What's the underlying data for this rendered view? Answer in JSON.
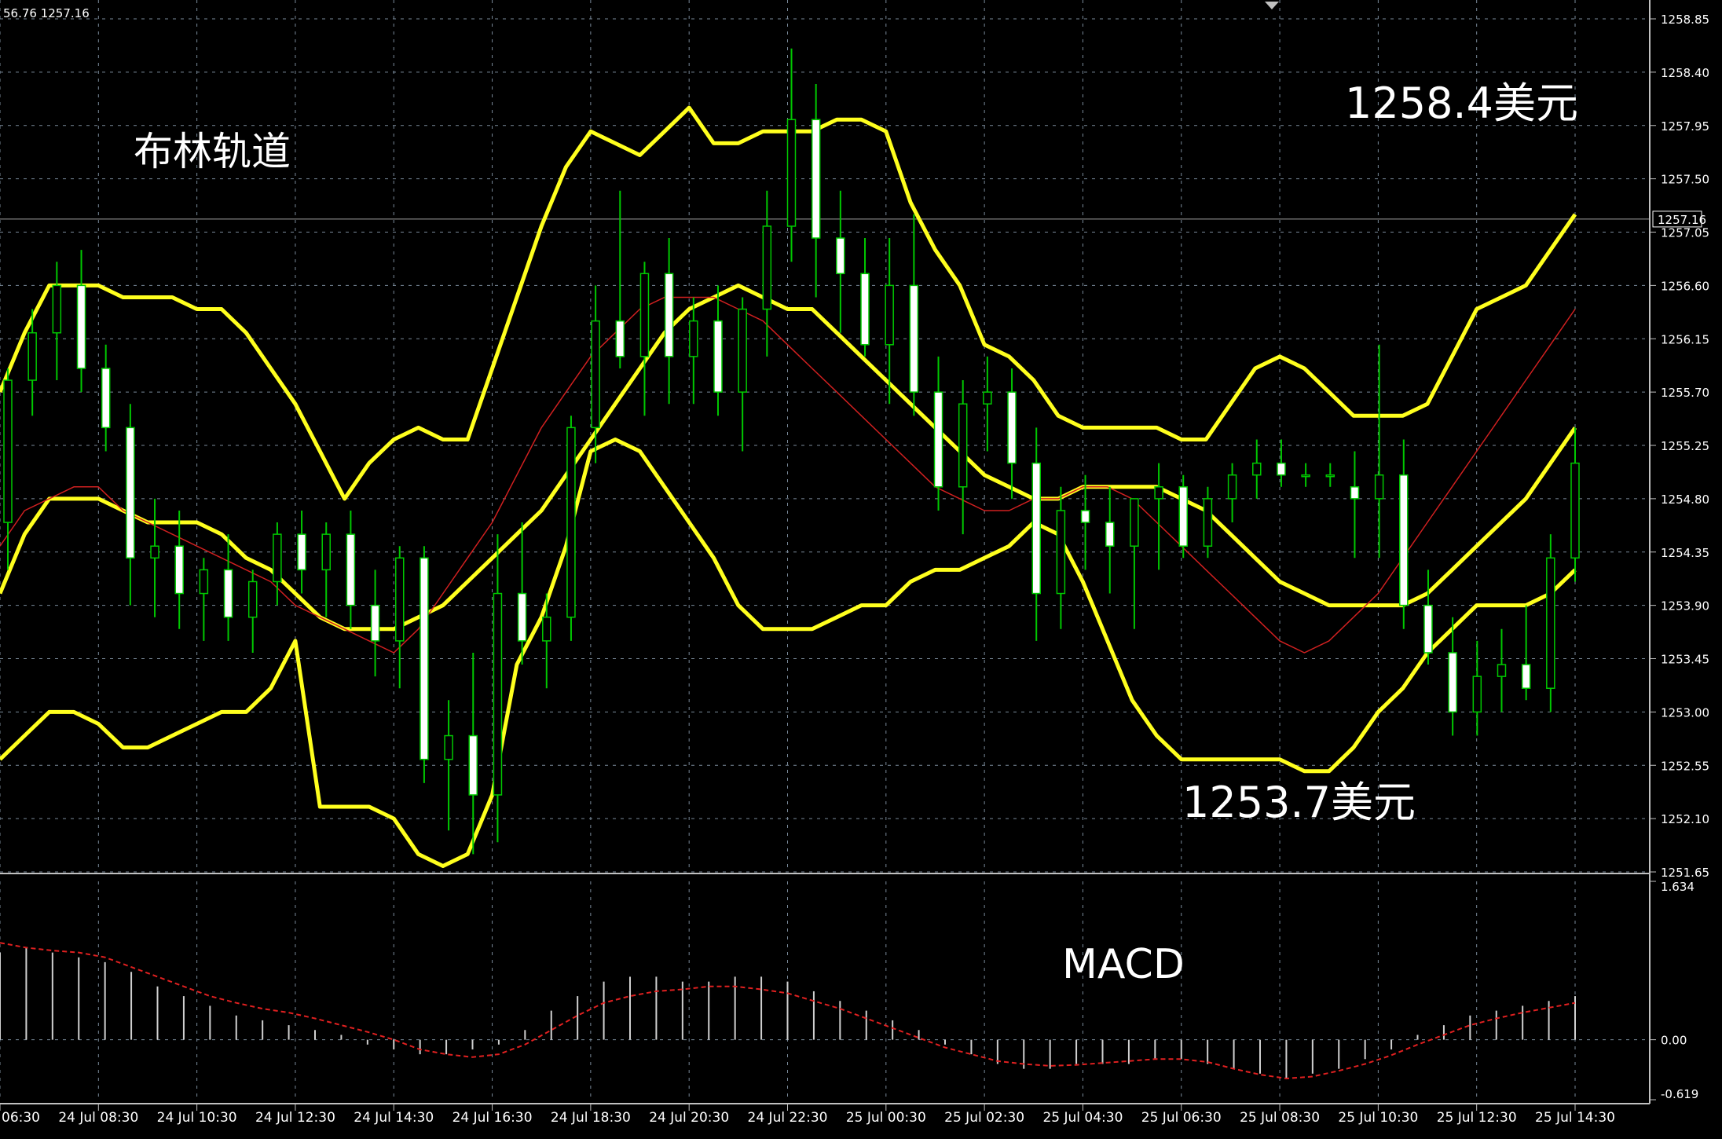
{
  "header": {
    "ohlc_readout": "56.76 1257.16"
  },
  "annotations": {
    "bollinger_label": "布林轨道",
    "high_label": "1258.4美元",
    "low_label": "1253.7美元",
    "macd_label": "MACD"
  },
  "colors": {
    "background": "#000000",
    "grid": "#7a8a9a",
    "candle_wick": "#00c800",
    "candle_bull_fill": "#000000",
    "candle_bear_fill": "#ffffff",
    "bollinger": "#ffff1e",
    "moving_average": "#d02020",
    "macd_histogram": "#d0d0d0",
    "macd_signal": "#e02020",
    "text": "#ffffff"
  },
  "chart_data": [
    {
      "type": "candlestick",
      "title": "",
      "price_ticks": [
        "1258.85",
        "1258.40",
        "1257.95",
        "1257.50",
        "1257.05",
        "1256.60",
        "1256.15",
        "1255.70",
        "1255.25",
        "1254.80",
        "1254.35",
        "1253.90",
        "1253.45",
        "1253.00",
        "1252.55",
        "1252.10",
        "1251.65"
      ],
      "price_ylim": [
        1251.65,
        1258.85
      ],
      "current_price": "1257.16",
      "time_ticks": [
        "06:30",
        "24 Jul 08:30",
        "24 Jul 10:30",
        "24 Jul 12:30",
        "24 Jul 14:30",
        "24 Jul 16:30",
        "24 Jul 18:30",
        "24 Jul 20:30",
        "24 Jul 22:30",
        "25 Jul 00:30",
        "25 Jul 02:30",
        "25 Jul 04:30",
        "25 Jul 06:30",
        "25 Jul 08:30",
        "25 Jul 10:30",
        "25 Jul 12:30",
        "25 Jul 14:30"
      ],
      "bollinger_upper": [
        1255.7,
        1256.2,
        1256.6,
        1256.6,
        1256.6,
        1256.5,
        1256.5,
        1256.5,
        1256.4,
        1256.4,
        1256.2,
        1255.9,
        1255.6,
        1255.2,
        1254.8,
        1255.1,
        1255.3,
        1255.4,
        1255.3,
        1255.3,
        1255.9,
        1256.5,
        1257.1,
        1257.6,
        1257.9,
        1257.8,
        1257.7,
        1257.9,
        1258.1,
        1257.8,
        1257.8,
        1257.9,
        1257.9,
        1257.9,
        1258.0,
        1258.0,
        1257.9,
        1257.3,
        1256.9,
        1256.6,
        1256.1,
        1256.0,
        1255.8,
        1255.5,
        1255.4,
        1255.4,
        1255.4,
        1255.4,
        1255.3,
        1255.3,
        1255.6,
        1255.9,
        1256.0,
        1255.9,
        1255.7,
        1255.5,
        1255.5,
        1255.5,
        1255.6,
        1256.0,
        1256.4,
        1256.5,
        1256.6,
        1256.9,
        1257.2
      ],
      "bollinger_middle": [
        1254.0,
        1254.5,
        1254.8,
        1254.8,
        1254.8,
        1254.7,
        1254.6,
        1254.6,
        1254.6,
        1254.5,
        1254.3,
        1254.2,
        1254.0,
        1253.8,
        1253.7,
        1253.7,
        1253.7,
        1253.8,
        1253.9,
        1254.1,
        1254.3,
        1254.5,
        1254.7,
        1255.0,
        1255.3,
        1255.6,
        1255.9,
        1256.2,
        1256.4,
        1256.5,
        1256.6,
        1256.5,
        1256.4,
        1256.4,
        1256.2,
        1256.0,
        1255.8,
        1255.6,
        1255.4,
        1255.2,
        1255.0,
        1254.9,
        1254.8,
        1254.8,
        1254.9,
        1254.9,
        1254.9,
        1254.9,
        1254.8,
        1254.7,
        1254.5,
        1254.3,
        1254.1,
        1254.0,
        1253.9,
        1253.9,
        1253.9,
        1253.9,
        1254.0,
        1254.2,
        1254.4,
        1254.6,
        1254.8,
        1255.1,
        1255.4
      ],
      "bollinger_lower": [
        1252.6,
        1252.8,
        1253.0,
        1253.0,
        1252.9,
        1252.7,
        1252.7,
        1252.8,
        1252.9,
        1253.0,
        1253.0,
        1253.2,
        1253.6,
        1252.2,
        1252.2,
        1252.2,
        1252.1,
        1251.8,
        1251.7,
        1251.8,
        1252.3,
        1253.4,
        1253.8,
        1254.4,
        1255.2,
        1255.3,
        1255.2,
        1254.9,
        1254.6,
        1254.3,
        1253.9,
        1253.7,
        1253.7,
        1253.7,
        1253.8,
        1253.9,
        1253.9,
        1254.1,
        1254.2,
        1254.2,
        1254.3,
        1254.4,
        1254.6,
        1254.5,
        1254.1,
        1253.6,
        1253.1,
        1252.8,
        1252.6,
        1252.6,
        1252.6,
        1252.6,
        1252.6,
        1252.5,
        1252.5,
        1252.7,
        1253.0,
        1253.2,
        1253.5,
        1253.7,
        1253.9,
        1253.9,
        1253.9,
        1254.0,
        1254.2
      ],
      "moving_average": [
        1254.4,
        1254.7,
        1254.8,
        1254.9,
        1254.9,
        1254.7,
        1254.6,
        1254.5,
        1254.4,
        1254.3,
        1254.2,
        1254.1,
        1253.9,
        1253.8,
        1253.7,
        1253.6,
        1253.5,
        1253.7,
        1254.0,
        1254.3,
        1254.6,
        1255.0,
        1255.4,
        1255.7,
        1256.0,
        1256.2,
        1256.4,
        1256.5,
        1256.5,
        1256.5,
        1256.4,
        1256.3,
        1256.1,
        1255.9,
        1255.7,
        1255.5,
        1255.3,
        1255.1,
        1254.9,
        1254.8,
        1254.7,
        1254.7,
        1254.8,
        1254.8,
        1254.9,
        1254.9,
        1254.8,
        1254.6,
        1254.4,
        1254.2,
        1254.0,
        1253.8,
        1253.6,
        1253.5,
        1253.6,
        1253.8,
        1254.0,
        1254.3,
        1254.6,
        1254.9,
        1255.2,
        1255.5,
        1255.8,
        1256.1,
        1256.4
      ],
      "candles": [
        {
          "o": 1254.6,
          "h": 1255.9,
          "l": 1254.2,
          "c": 1255.8
        },
        {
          "o": 1255.8,
          "h": 1256.4,
          "l": 1255.5,
          "c": 1256.2
        },
        {
          "o": 1256.2,
          "h": 1256.8,
          "l": 1255.8,
          "c": 1256.6
        },
        {
          "o": 1256.6,
          "h": 1256.9,
          "l": 1255.7,
          "c": 1255.9
        },
        {
          "o": 1255.9,
          "h": 1256.1,
          "l": 1255.2,
          "c": 1255.4
        },
        {
          "o": 1255.4,
          "h": 1255.6,
          "l": 1253.9,
          "c": 1254.3
        },
        {
          "o": 1254.3,
          "h": 1254.8,
          "l": 1253.8,
          "c": 1254.4
        },
        {
          "o": 1254.4,
          "h": 1254.7,
          "l": 1253.7,
          "c": 1254.0
        },
        {
          "o": 1254.0,
          "h": 1254.3,
          "l": 1253.6,
          "c": 1254.2
        },
        {
          "o": 1254.2,
          "h": 1254.5,
          "l": 1253.6,
          "c": 1253.8
        },
        {
          "o": 1253.8,
          "h": 1254.2,
          "l": 1253.5,
          "c": 1254.1
        },
        {
          "o": 1254.1,
          "h": 1254.6,
          "l": 1253.9,
          "c": 1254.5
        },
        {
          "o": 1254.5,
          "h": 1254.7,
          "l": 1254.0,
          "c": 1254.2
        },
        {
          "o": 1254.2,
          "h": 1254.6,
          "l": 1253.8,
          "c": 1254.5
        },
        {
          "o": 1254.5,
          "h": 1254.7,
          "l": 1253.7,
          "c": 1253.9
        },
        {
          "o": 1253.9,
          "h": 1254.2,
          "l": 1253.3,
          "c": 1253.6
        },
        {
          "o": 1253.6,
          "h": 1254.4,
          "l": 1253.2,
          "c": 1254.3
        },
        {
          "o": 1254.3,
          "h": 1254.4,
          "l": 1252.4,
          "c": 1252.6
        },
        {
          "o": 1252.6,
          "h": 1253.1,
          "l": 1252.0,
          "c": 1252.8
        },
        {
          "o": 1252.8,
          "h": 1253.5,
          "l": 1251.8,
          "c": 1252.3
        },
        {
          "o": 1252.3,
          "h": 1254.5,
          "l": 1251.9,
          "c": 1254.0
        },
        {
          "o": 1254.0,
          "h": 1254.6,
          "l": 1253.4,
          "c": 1253.6
        },
        {
          "o": 1253.6,
          "h": 1254.0,
          "l": 1253.2,
          "c": 1253.8
        },
        {
          "o": 1253.8,
          "h": 1255.5,
          "l": 1253.6,
          "c": 1255.4
        },
        {
          "o": 1255.4,
          "h": 1256.6,
          "l": 1255.1,
          "c": 1256.3
        },
        {
          "o": 1256.3,
          "h": 1257.4,
          "l": 1255.9,
          "c": 1256.0
        },
        {
          "o": 1256.0,
          "h": 1256.8,
          "l": 1255.5,
          "c": 1256.7
        },
        {
          "o": 1256.7,
          "h": 1257.0,
          "l": 1255.6,
          "c": 1256.0
        },
        {
          "o": 1256.0,
          "h": 1256.5,
          "l": 1255.6,
          "c": 1256.3
        },
        {
          "o": 1256.3,
          "h": 1256.6,
          "l": 1255.5,
          "c": 1255.7
        },
        {
          "o": 1255.7,
          "h": 1256.5,
          "l": 1255.2,
          "c": 1256.4
        },
        {
          "o": 1256.4,
          "h": 1257.4,
          "l": 1256.0,
          "c": 1257.1
        },
        {
          "o": 1257.1,
          "h": 1258.6,
          "l": 1256.8,
          "c": 1258.0
        },
        {
          "o": 1258.0,
          "h": 1258.3,
          "l": 1256.5,
          "c": 1257.0
        },
        {
          "o": 1257.0,
          "h": 1257.4,
          "l": 1256.2,
          "c": 1256.7
        },
        {
          "o": 1256.7,
          "h": 1257.0,
          "l": 1256.0,
          "c": 1256.1
        },
        {
          "o": 1256.1,
          "h": 1257.0,
          "l": 1255.6,
          "c": 1256.6
        },
        {
          "o": 1256.6,
          "h": 1257.2,
          "l": 1255.5,
          "c": 1255.7
        },
        {
          "o": 1255.7,
          "h": 1256.0,
          "l": 1254.7,
          "c": 1254.9
        },
        {
          "o": 1254.9,
          "h": 1255.8,
          "l": 1254.5,
          "c": 1255.6
        },
        {
          "o": 1255.6,
          "h": 1256.0,
          "l": 1255.2,
          "c": 1255.7
        },
        {
          "o": 1255.7,
          "h": 1255.9,
          "l": 1254.8,
          "c": 1255.1
        },
        {
          "o": 1255.1,
          "h": 1255.4,
          "l": 1253.6,
          "c": 1254.0
        },
        {
          "o": 1254.0,
          "h": 1254.9,
          "l": 1253.7,
          "c": 1254.7
        },
        {
          "o": 1254.7,
          "h": 1255.0,
          "l": 1254.2,
          "c": 1254.6
        },
        {
          "o": 1254.6,
          "h": 1254.9,
          "l": 1254.0,
          "c": 1254.4
        },
        {
          "o": 1254.4,
          "h": 1254.7,
          "l": 1253.7,
          "c": 1254.8
        },
        {
          "o": 1254.8,
          "h": 1255.1,
          "l": 1254.2,
          "c": 1254.9
        },
        {
          "o": 1254.9,
          "h": 1255.0,
          "l": 1254.3,
          "c": 1254.4
        },
        {
          "o": 1254.4,
          "h": 1254.9,
          "l": 1254.3,
          "c": 1254.8
        },
        {
          "o": 1254.8,
          "h": 1255.1,
          "l": 1254.6,
          "c": 1255.0
        },
        {
          "o": 1255.0,
          "h": 1255.3,
          "l": 1254.8,
          "c": 1255.1
        },
        {
          "o": 1255.1,
          "h": 1255.3,
          "l": 1254.9,
          "c": 1255.0
        },
        {
          "o": 1255.0,
          "h": 1255.1,
          "l": 1254.9,
          "c": 1255.0
        },
        {
          "o": 1255.0,
          "h": 1255.1,
          "l": 1254.9,
          "c": 1255.0
        },
        {
          "o": 1254.9,
          "h": 1255.2,
          "l": 1254.3,
          "c": 1254.8
        },
        {
          "o": 1254.8,
          "h": 1256.1,
          "l": 1254.3,
          "c": 1255.0
        },
        {
          "o": 1255.0,
          "h": 1255.3,
          "l": 1253.7,
          "c": 1253.9
        },
        {
          "o": 1253.9,
          "h": 1254.2,
          "l": 1253.4,
          "c": 1253.5
        },
        {
          "o": 1253.5,
          "h": 1253.8,
          "l": 1252.8,
          "c": 1253.0
        },
        {
          "o": 1253.0,
          "h": 1253.6,
          "l": 1252.8,
          "c": 1253.3
        },
        {
          "o": 1253.3,
          "h": 1253.7,
          "l": 1253.0,
          "c": 1253.4
        },
        {
          "o": 1253.4,
          "h": 1253.9,
          "l": 1253.1,
          "c": 1253.2
        },
        {
          "o": 1253.2,
          "h": 1254.5,
          "l": 1253.0,
          "c": 1254.3
        },
        {
          "o": 1254.3,
          "h": 1255.4,
          "l": 1254.1,
          "c": 1255.1
        }
      ]
    },
    {
      "type": "bar",
      "title": "MACD",
      "ticks": [
        "1.634",
        "0.00",
        "-0.619"
      ],
      "ylim": [
        -0.619,
        1.634
      ],
      "histogram": [
        0.9,
        0.95,
        0.9,
        0.85,
        0.8,
        0.7,
        0.55,
        0.45,
        0.35,
        0.25,
        0.2,
        0.15,
        0.1,
        0.05,
        -0.05,
        -0.1,
        -0.15,
        -0.15,
        -0.1,
        -0.05,
        0.1,
        0.3,
        0.45,
        0.6,
        0.65,
        0.65,
        0.6,
        0.6,
        0.65,
        0.65,
        0.6,
        0.5,
        0.4,
        0.3,
        0.2,
        0.1,
        -0.05,
        -0.15,
        -0.25,
        -0.3,
        -0.3,
        -0.25,
        -0.25,
        -0.25,
        -0.2,
        -0.2,
        -0.25,
        -0.3,
        -0.35,
        -0.4,
        -0.35,
        -0.3,
        -0.2,
        -0.1,
        0.05,
        0.15,
        0.25,
        0.3,
        0.35,
        0.4,
        0.45
      ],
      "signal": [
        1.0,
        0.95,
        0.92,
        0.9,
        0.85,
        0.75,
        0.65,
        0.55,
        0.45,
        0.38,
        0.32,
        0.28,
        0.22,
        0.15,
        0.08,
        0.0,
        -0.1,
        -0.15,
        -0.18,
        -0.15,
        -0.05,
        0.1,
        0.25,
        0.38,
        0.45,
        0.5,
        0.52,
        0.55,
        0.55,
        0.52,
        0.48,
        0.4,
        0.32,
        0.22,
        0.12,
        0.02,
        -0.08,
        -0.15,
        -0.22,
        -0.25,
        -0.27,
        -0.26,
        -0.24,
        -0.22,
        -0.2,
        -0.2,
        -0.23,
        -0.3,
        -0.36,
        -0.4,
        -0.38,
        -0.32,
        -0.25,
        -0.16,
        -0.05,
        0.05,
        0.15,
        0.22,
        0.28,
        0.33,
        0.38
      ]
    }
  ]
}
